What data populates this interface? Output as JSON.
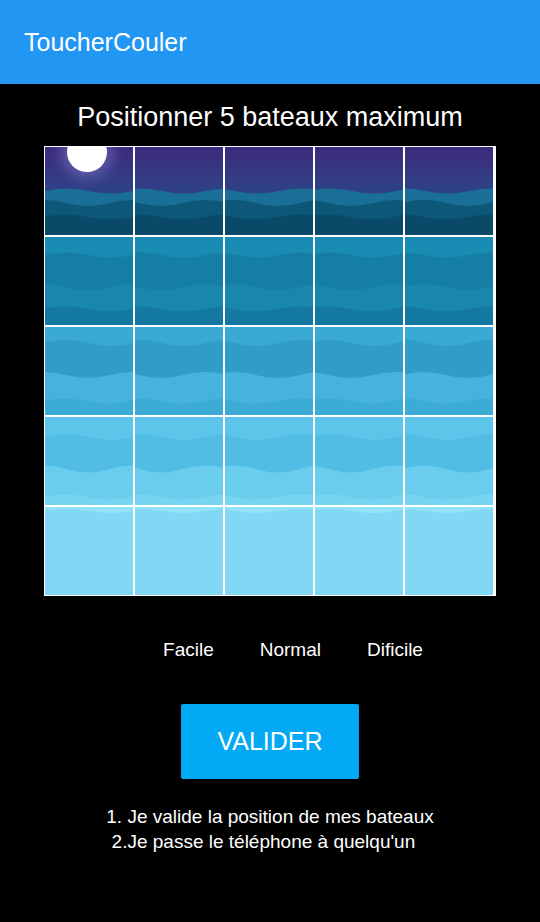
{
  "app_bar": {
    "title": "ToucherCouler"
  },
  "instruction_title": "Positionner 5 bateaux maximum",
  "grid": {
    "rows": [
      [
        {
          "ship": false
        },
        {
          "ship": false
        },
        {
          "ship": false
        },
        {
          "ship": false
        },
        {
          "ship": false
        }
      ],
      [
        {
          "ship": false
        },
        {
          "ship": false
        },
        {
          "ship": false
        },
        {
          "ship": false
        },
        {
          "ship": false
        }
      ],
      [
        {
          "ship": false
        },
        {
          "ship": false
        },
        {
          "ship": false
        },
        {
          "ship": false
        },
        {
          "ship": false
        }
      ],
      [
        {
          "ship": false
        },
        {
          "ship": false
        },
        {
          "ship": false
        },
        {
          "ship": false
        },
        {
          "ship": false
        }
      ],
      [
        {
          "ship": false
        },
        {
          "ship": false
        },
        {
          "ship": false
        },
        {
          "ship": false
        },
        {
          "ship": false
        }
      ]
    ]
  },
  "difficulties": [
    "Facile",
    "Normal",
    "Dificile"
  ],
  "buttons": [
    "VALIDER"
  ],
  "steps": [
    "1. Je valide la position de mes bateaux",
    " 2.Je passe le téléphone à quelqu'un"
  ]
}
